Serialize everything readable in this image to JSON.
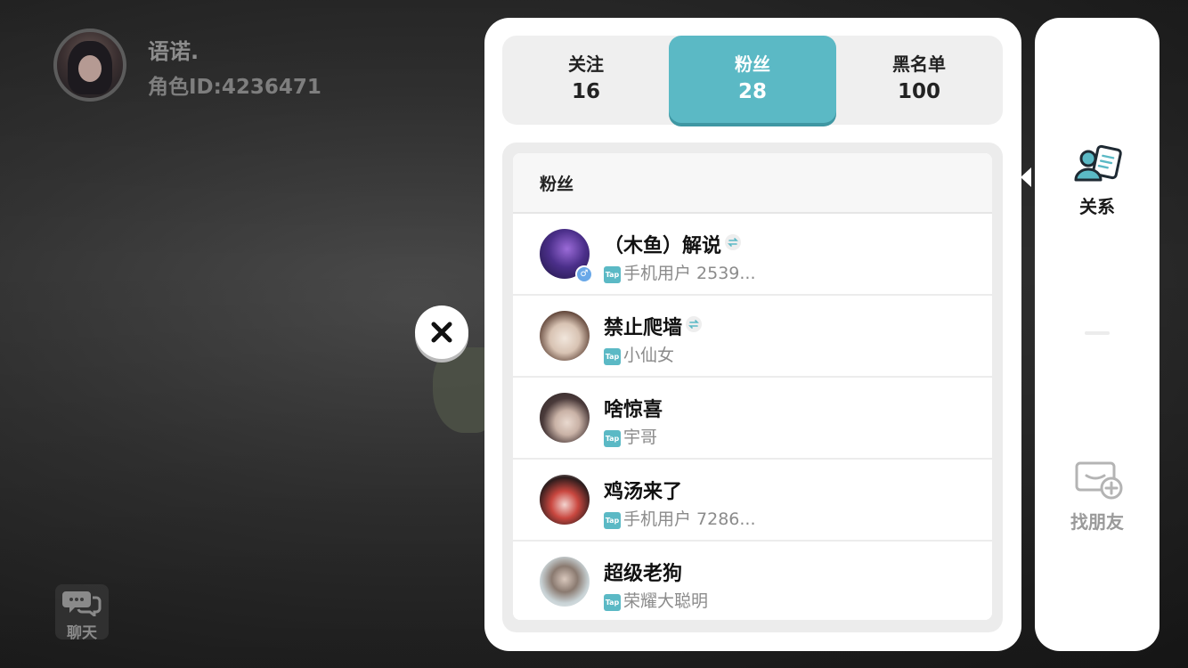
{
  "profile": {
    "name": "语诺.",
    "role_id": "角色ID:4236471"
  },
  "chat": {
    "label": "聊天",
    "icon": "chat-bubbles-icon"
  },
  "close": {
    "icon": "close-x-icon"
  },
  "tabs": [
    {
      "label": "关注",
      "count": "16",
      "active": false
    },
    {
      "label": "粉丝",
      "count": "28",
      "active": true
    },
    {
      "label": "黑名单",
      "count": "100",
      "active": false
    }
  ],
  "list": {
    "header": "粉丝",
    "rows": [
      {
        "name": "（木鱼）解说",
        "mutual": true,
        "platform": "Tap",
        "subtitle": "手机用户 2539...",
        "gender": "♂"
      },
      {
        "name": "禁止爬墙",
        "mutual": true,
        "platform": "Tap",
        "subtitle": "小仙女"
      },
      {
        "name": "啥惊喜",
        "mutual": false,
        "platform": "Tap",
        "subtitle": "宇哥"
      },
      {
        "name": " 鸡汤来了",
        "mutual": false,
        "platform": "Tap",
        "subtitle": "手机用户 7286..."
      },
      {
        "name": "超级老狗",
        "mutual": false,
        "platform": "Tap",
        "subtitle": "荣耀大聪明"
      }
    ]
  },
  "sidebar": {
    "items": [
      {
        "label": "关系",
        "icon": "relationship-icon",
        "active": true
      },
      {
        "label": "找朋友",
        "icon": "find-friend-icon",
        "active": false
      }
    ]
  },
  "colors": {
    "accent": "#5bb9c5",
    "accent_shadow": "#3f97a3",
    "text_dark": "#111111",
    "text_muted": "#8b8b8b"
  }
}
